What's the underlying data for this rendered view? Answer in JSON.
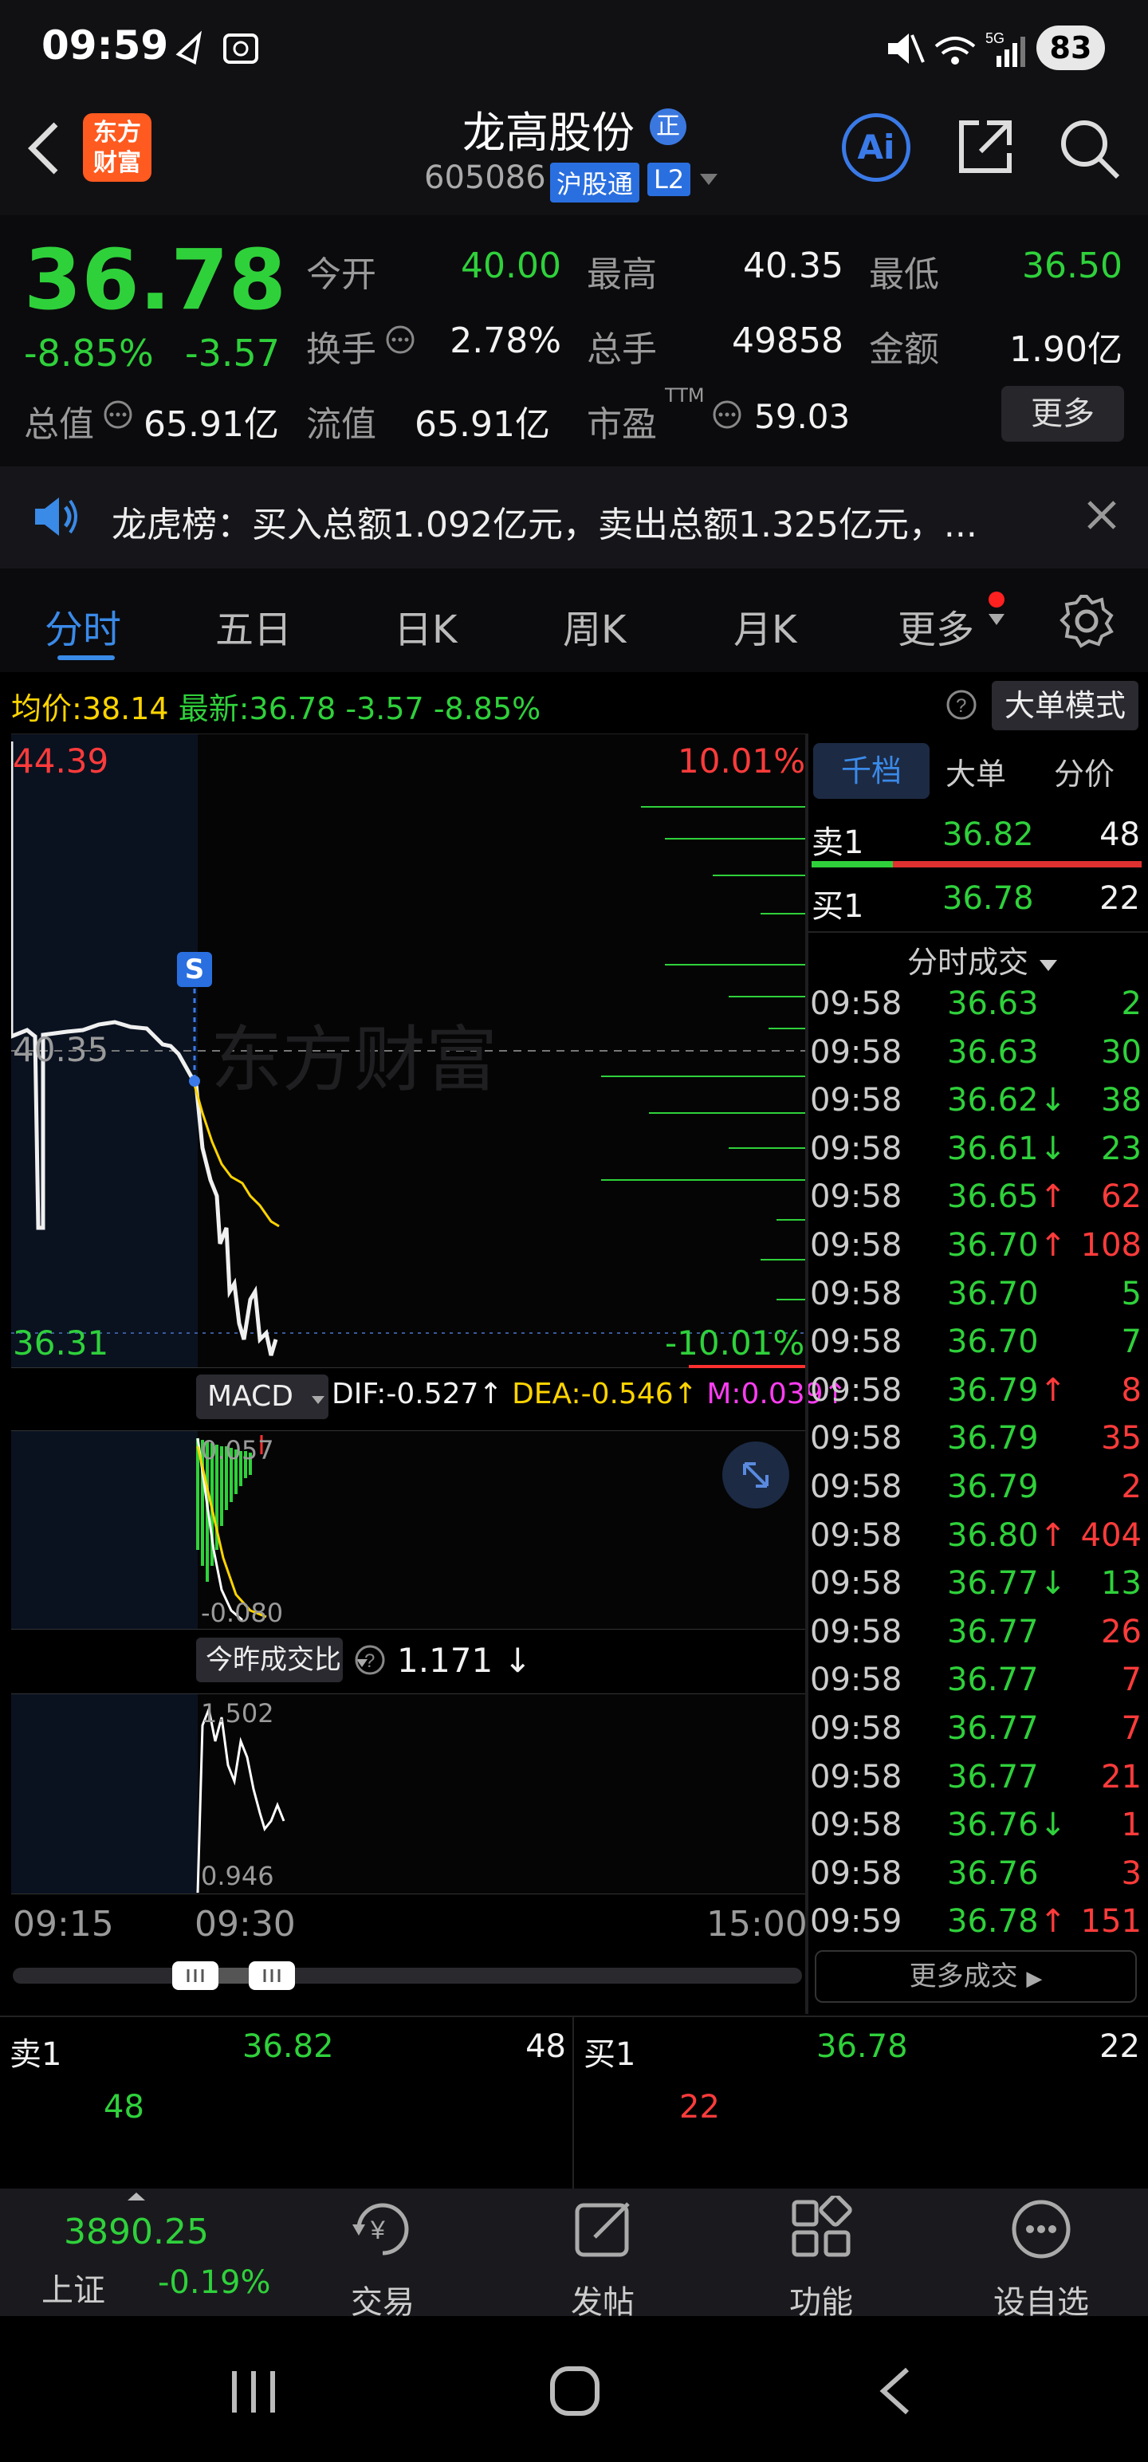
{
  "status_bar": {
    "time": "09:59",
    "battery": "83",
    "network": "5G"
  },
  "header": {
    "logo_text": "东方\n财富",
    "stock_name": "龙高股份",
    "name_badge": "正",
    "stock_code": "605086",
    "tag_hgt": "沪股通",
    "tag_l2": "L2",
    "ai_label": "Ai"
  },
  "quote": {
    "price": "36.78",
    "change_pct": "-8.85%",
    "change": "-3.57",
    "labels": {
      "open": "今开",
      "high": "最高",
      "low": "最低",
      "turnover": "换手",
      "volume": "总手",
      "amount": "金额",
      "total_value": "总值",
      "float_value": "流值",
      "pe": "市盈",
      "pe_sup": "TTM"
    },
    "open": "40.00",
    "high": "40.35",
    "low": "36.50",
    "turnover": "2.78%",
    "volume": "49858",
    "amount": "1.90亿",
    "total_value": "65.91亿",
    "float_value": "65.91亿",
    "pe": "59.03",
    "more_btn": "更多"
  },
  "notice": {
    "text": "龙虎榜：买入总额1.092亿元，卖出总额1.325亿元，..."
  },
  "tabs": [
    "分时",
    "五日",
    "日K",
    "周K",
    "月K",
    "更多"
  ],
  "chart_header": {
    "avg_label": "均价:",
    "avg_value": "38.14",
    "latest_label": "最新:",
    "latest_value": "36.78",
    "latest_change": "-3.57",
    "latest_pct": "-8.85%",
    "mode_btn": "大单模式"
  },
  "chart_labels": {
    "high": "44.39",
    "mid": "40.35",
    "low": "36.31",
    "pct_high": "10.01%",
    "pct_low": "-10.01%",
    "watermark": "东方财富",
    "s_marker": "S",
    "macd_btn": "MACD",
    "dif": "DIF:-0.527",
    "dea": "DEA:-0.546",
    "m": "M:0.039",
    "macd_top": "0.057",
    "macd_bottom": "-0.080",
    "ratio_btn": "今昨成交比",
    "ratio_value": "1.171",
    "ratio_top": "1.502",
    "ratio_bottom": "0.946",
    "time_start": "09:15",
    "time_mid": "09:30",
    "time_end": "15:00"
  },
  "sidebar": {
    "tabs": [
      "千档",
      "大单",
      "分价"
    ],
    "sell1_label": "卖1",
    "sell1_price": "36.82",
    "sell1_vol": "48",
    "buy1_label": "买1",
    "buy1_price": "36.78",
    "buy1_vol": "22",
    "ticks_title": "分时成交",
    "ticks": [
      {
        "t": "09:58",
        "p": "36.63",
        "v": "2",
        "vc": "green",
        "a": ""
      },
      {
        "t": "09:58",
        "p": "36.63",
        "v": "30",
        "vc": "green",
        "a": ""
      },
      {
        "t": "09:58",
        "p": "36.62",
        "v": "38",
        "vc": "green",
        "a": "↓"
      },
      {
        "t": "09:58",
        "p": "36.61",
        "v": "23",
        "vc": "green",
        "a": "↓"
      },
      {
        "t": "09:58",
        "p": "36.65",
        "v": "62",
        "vc": "red",
        "a": "↑"
      },
      {
        "t": "09:58",
        "p": "36.70",
        "v": "108",
        "vc": "red",
        "a": "↑"
      },
      {
        "t": "09:58",
        "p": "36.70",
        "v": "5",
        "vc": "green",
        "a": ""
      },
      {
        "t": "09:58",
        "p": "36.70",
        "v": "7",
        "vc": "green",
        "a": ""
      },
      {
        "t": "09:58",
        "p": "36.79",
        "v": "8",
        "vc": "red",
        "a": "↑"
      },
      {
        "t": "09:58",
        "p": "36.79",
        "v": "35",
        "vc": "red",
        "a": ""
      },
      {
        "t": "09:58",
        "p": "36.79",
        "v": "2",
        "vc": "red",
        "a": ""
      },
      {
        "t": "09:58",
        "p": "36.80",
        "v": "404",
        "vc": "red",
        "a": "↑"
      },
      {
        "t": "09:58",
        "p": "36.77",
        "v": "13",
        "vc": "green",
        "a": "↓"
      },
      {
        "t": "09:58",
        "p": "36.77",
        "v": "26",
        "vc": "red",
        "a": ""
      },
      {
        "t": "09:58",
        "p": "36.77",
        "v": "7",
        "vc": "red",
        "a": ""
      },
      {
        "t": "09:58",
        "p": "36.77",
        "v": "7",
        "vc": "red",
        "a": ""
      },
      {
        "t": "09:58",
        "p": "36.77",
        "v": "21",
        "vc": "red",
        "a": ""
      },
      {
        "t": "09:58",
        "p": "36.76",
        "v": "1",
        "vc": "red",
        "a": "↓"
      },
      {
        "t": "09:58",
        "p": "36.76",
        "v": "3",
        "vc": "red",
        "a": ""
      },
      {
        "t": "09:59",
        "p": "36.78",
        "v": "151",
        "vc": "red",
        "a": "↑"
      }
    ],
    "more_ticks": "更多成交"
  },
  "bottom_book": {
    "sell_label": "卖1",
    "sell_price": "36.82",
    "sell_vol": "48",
    "sell_qty": "48",
    "buy_label": "买1",
    "buy_price": "36.78",
    "buy_vol": "22",
    "buy_qty": "22"
  },
  "bottom_nav": {
    "index_value": "3890.25",
    "index_name": "上证",
    "index_change": "-0.19%",
    "items": [
      "交易",
      "发帖",
      "功能",
      "设自选"
    ]
  }
}
